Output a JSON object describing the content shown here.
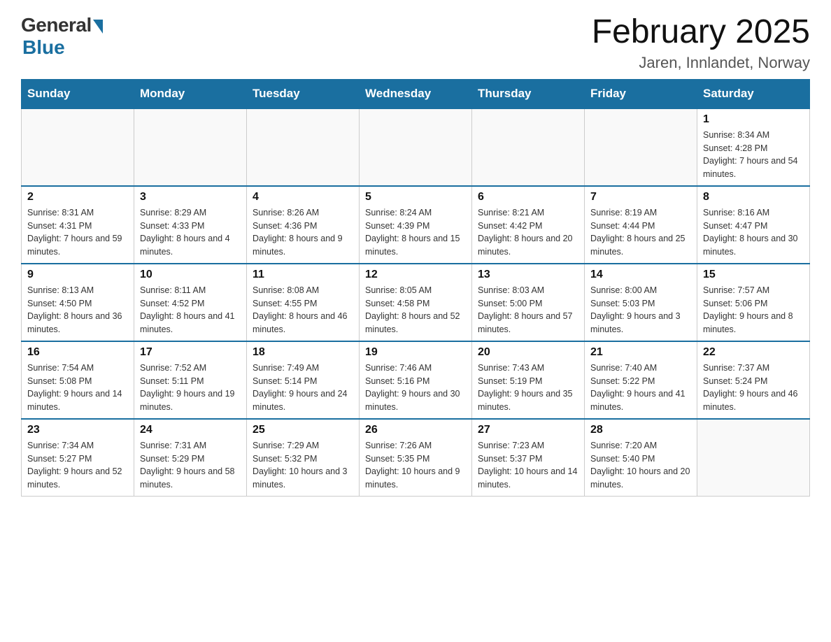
{
  "header": {
    "logo": {
      "general": "General",
      "blue": "Blue"
    },
    "title": "February 2025",
    "location": "Jaren, Innlandet, Norway"
  },
  "days_of_week": [
    "Sunday",
    "Monday",
    "Tuesday",
    "Wednesday",
    "Thursday",
    "Friday",
    "Saturday"
  ],
  "weeks": [
    [
      {
        "day": "",
        "info": ""
      },
      {
        "day": "",
        "info": ""
      },
      {
        "day": "",
        "info": ""
      },
      {
        "day": "",
        "info": ""
      },
      {
        "day": "",
        "info": ""
      },
      {
        "day": "",
        "info": ""
      },
      {
        "day": "1",
        "info": "Sunrise: 8:34 AM\nSunset: 4:28 PM\nDaylight: 7 hours and 54 minutes."
      }
    ],
    [
      {
        "day": "2",
        "info": "Sunrise: 8:31 AM\nSunset: 4:31 PM\nDaylight: 7 hours and 59 minutes."
      },
      {
        "day": "3",
        "info": "Sunrise: 8:29 AM\nSunset: 4:33 PM\nDaylight: 8 hours and 4 minutes."
      },
      {
        "day": "4",
        "info": "Sunrise: 8:26 AM\nSunset: 4:36 PM\nDaylight: 8 hours and 9 minutes."
      },
      {
        "day": "5",
        "info": "Sunrise: 8:24 AM\nSunset: 4:39 PM\nDaylight: 8 hours and 15 minutes."
      },
      {
        "day": "6",
        "info": "Sunrise: 8:21 AM\nSunset: 4:42 PM\nDaylight: 8 hours and 20 minutes."
      },
      {
        "day": "7",
        "info": "Sunrise: 8:19 AM\nSunset: 4:44 PM\nDaylight: 8 hours and 25 minutes."
      },
      {
        "day": "8",
        "info": "Sunrise: 8:16 AM\nSunset: 4:47 PM\nDaylight: 8 hours and 30 minutes."
      }
    ],
    [
      {
        "day": "9",
        "info": "Sunrise: 8:13 AM\nSunset: 4:50 PM\nDaylight: 8 hours and 36 minutes."
      },
      {
        "day": "10",
        "info": "Sunrise: 8:11 AM\nSunset: 4:52 PM\nDaylight: 8 hours and 41 minutes."
      },
      {
        "day": "11",
        "info": "Sunrise: 8:08 AM\nSunset: 4:55 PM\nDaylight: 8 hours and 46 minutes."
      },
      {
        "day": "12",
        "info": "Sunrise: 8:05 AM\nSunset: 4:58 PM\nDaylight: 8 hours and 52 minutes."
      },
      {
        "day": "13",
        "info": "Sunrise: 8:03 AM\nSunset: 5:00 PM\nDaylight: 8 hours and 57 minutes."
      },
      {
        "day": "14",
        "info": "Sunrise: 8:00 AM\nSunset: 5:03 PM\nDaylight: 9 hours and 3 minutes."
      },
      {
        "day": "15",
        "info": "Sunrise: 7:57 AM\nSunset: 5:06 PM\nDaylight: 9 hours and 8 minutes."
      }
    ],
    [
      {
        "day": "16",
        "info": "Sunrise: 7:54 AM\nSunset: 5:08 PM\nDaylight: 9 hours and 14 minutes."
      },
      {
        "day": "17",
        "info": "Sunrise: 7:52 AM\nSunset: 5:11 PM\nDaylight: 9 hours and 19 minutes."
      },
      {
        "day": "18",
        "info": "Sunrise: 7:49 AM\nSunset: 5:14 PM\nDaylight: 9 hours and 24 minutes."
      },
      {
        "day": "19",
        "info": "Sunrise: 7:46 AM\nSunset: 5:16 PM\nDaylight: 9 hours and 30 minutes."
      },
      {
        "day": "20",
        "info": "Sunrise: 7:43 AM\nSunset: 5:19 PM\nDaylight: 9 hours and 35 minutes."
      },
      {
        "day": "21",
        "info": "Sunrise: 7:40 AM\nSunset: 5:22 PM\nDaylight: 9 hours and 41 minutes."
      },
      {
        "day": "22",
        "info": "Sunrise: 7:37 AM\nSunset: 5:24 PM\nDaylight: 9 hours and 46 minutes."
      }
    ],
    [
      {
        "day": "23",
        "info": "Sunrise: 7:34 AM\nSunset: 5:27 PM\nDaylight: 9 hours and 52 minutes."
      },
      {
        "day": "24",
        "info": "Sunrise: 7:31 AM\nSunset: 5:29 PM\nDaylight: 9 hours and 58 minutes."
      },
      {
        "day": "25",
        "info": "Sunrise: 7:29 AM\nSunset: 5:32 PM\nDaylight: 10 hours and 3 minutes."
      },
      {
        "day": "26",
        "info": "Sunrise: 7:26 AM\nSunset: 5:35 PM\nDaylight: 10 hours and 9 minutes."
      },
      {
        "day": "27",
        "info": "Sunrise: 7:23 AM\nSunset: 5:37 PM\nDaylight: 10 hours and 14 minutes."
      },
      {
        "day": "28",
        "info": "Sunrise: 7:20 AM\nSunset: 5:40 PM\nDaylight: 10 hours and 20 minutes."
      },
      {
        "day": "",
        "info": ""
      }
    ]
  ]
}
